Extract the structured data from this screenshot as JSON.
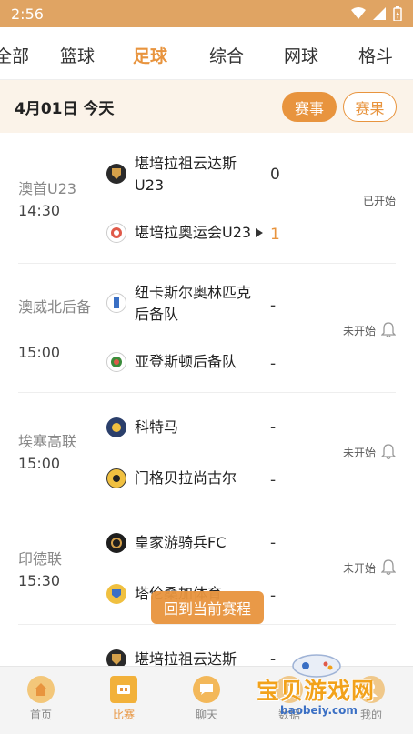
{
  "status_bar": {
    "time": "2:56"
  },
  "tabs": [
    {
      "label": "全部"
    },
    {
      "label": "篮球"
    },
    {
      "label": "足球"
    },
    {
      "label": "综合"
    },
    {
      "label": "网球"
    },
    {
      "label": "格斗"
    }
  ],
  "date_row": {
    "date": "4月01日 今天",
    "btn_events": "赛事",
    "btn_results": "赛果"
  },
  "matches": [
    {
      "league": "澳首U23",
      "time": "14:30",
      "home": "堪培拉祖云达斯U23",
      "away": "堪培拉奥运会U23",
      "home_score": "0",
      "away_score": "1",
      "status": "已开始"
    },
    {
      "league": "澳威北后备",
      "time": "15:00",
      "home": "纽卡斯尔奥林匹克后备队",
      "away": "亚登斯顿后备队",
      "home_score": "-",
      "away_score": "-",
      "status": "未开始"
    },
    {
      "league": "埃塞高联",
      "time": "15:00",
      "home": "科特马",
      "away": "门格贝拉尚古尔",
      "home_score": "-",
      "away_score": "-",
      "status": "未开始"
    },
    {
      "league": "印德联",
      "time": "15:30",
      "home": "皇家游骑兵FC",
      "away": "塔伦桑加体育",
      "home_score": "-",
      "away_score": "-",
      "status": "未开始"
    },
    {
      "league": "",
      "time": "",
      "home": "堪培拉祖云达斯",
      "away": "",
      "home_score": "-",
      "away_score": "",
      "status": ""
    }
  ],
  "float_button": "回到当前赛程",
  "bottom_nav": [
    {
      "label": "首页"
    },
    {
      "label": "比赛"
    },
    {
      "label": "聊天"
    },
    {
      "label": "数据"
    },
    {
      "label": "我的"
    }
  ],
  "watermark": {
    "title": "宝贝游戏网",
    "url": "baobeiy.com"
  },
  "colors": {
    "accent": "#e8943e",
    "status_bar": "#e0a463",
    "date_row_bg": "#fbf3e9"
  }
}
